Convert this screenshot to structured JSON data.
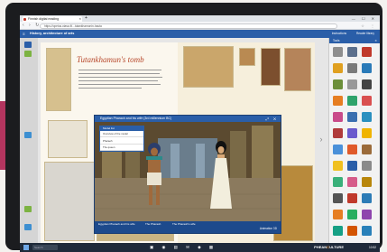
{
  "browser": {
    "tab_title": "Finnish digital reading",
    "url": "https://opetus.otava.fi/...tutankhamonin-hauta",
    "win_controls": "— ☐ ✕"
  },
  "app": {
    "menu_icon": "hamburger-icon",
    "title": "History, architecture of arts",
    "right_items": [
      "Instructions",
      "Reader library"
    ]
  },
  "book": {
    "title": "Tutankhamun's tomb"
  },
  "video": {
    "title": "Egyptian Pharaoh and his wife (3rd millennium BC)",
    "popup": {
      "header": "Model list",
      "items": [
        "Overview of the model",
        "Pharaoh",
        "The queen"
      ]
    },
    "footer_items": [
      "Egyptian Pharaoh and his wife",
      "The Pharaoh",
      "The Pharaoh's wife"
    ],
    "footer_right": "Animation 3D"
  },
  "sidebar": {
    "title": "Tools"
  },
  "taskbar": {
    "search_placeholder": "Search",
    "brand_a": "PHEAN",
    "brand_b": "C",
    "brand_c": "ULTURE",
    "clock": "10:52"
  },
  "colors": {
    "accent": "#2a5ea8",
    "brand_pink": "#b3355f",
    "title_red": "#b7472a"
  }
}
